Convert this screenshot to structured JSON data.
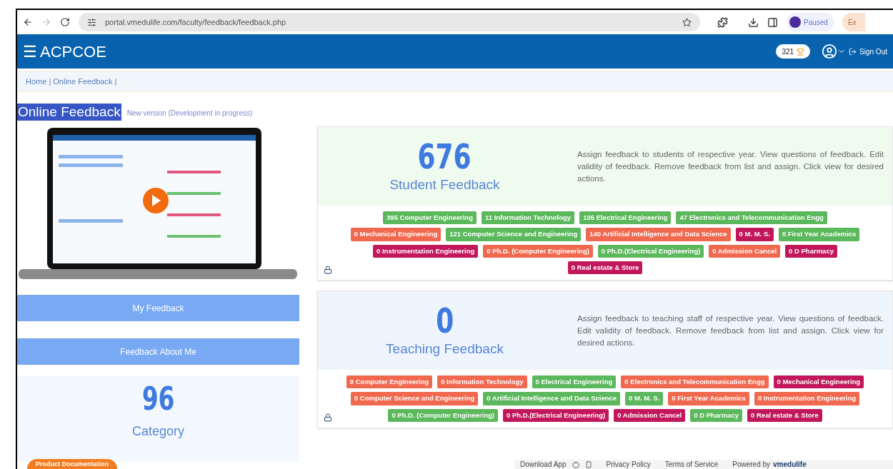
{
  "browser": {
    "url": "portal.vmedulife.com/faculty/feedback/feedback.php",
    "profile": "Paused",
    "extra": "Ex"
  },
  "header": {
    "menu_glyph": "☰",
    "brand": "ACPCOE",
    "points": "321",
    "sign_out": "Sign Out"
  },
  "breadcrumb": "Home | Online Feedback |",
  "page": {
    "title": "Online Feedback",
    "subtitle": "New version (Development in progress)"
  },
  "left": {
    "buttons": [
      "My Feedback",
      "Feedback About Me"
    ],
    "category": {
      "count": "96",
      "label": "Category"
    },
    "doc_badge": "Product Documentation"
  },
  "cards": [
    {
      "count": "676",
      "label": "Student Feedback",
      "color": "#effbee",
      "description": "Assign feedback to students of respective year. View questions of feedback. Edit validity of feedback. Remove feedback from list and assign. Click view for desired actions.",
      "tags": [
        {
          "text": "395 Computer Engineering",
          "color": "#5cb85c"
        },
        {
          "text": "11 Information Technology",
          "color": "#5cb85c"
        },
        {
          "text": "105 Electrical Engineering",
          "color": "#5cb85c"
        },
        {
          "text": "47 Electronics and Telecommunication Engg",
          "color": "#5cb85c"
        },
        {
          "text": "0 Mechanical Engineering",
          "color": "#f0694f"
        },
        {
          "text": "121 Computer Science and Engineering",
          "color": "#5cb85c"
        },
        {
          "text": "140 Artificial Intelligence and Data Science",
          "color": "#f0694f"
        },
        {
          "text": "0 M. M. S.",
          "color": "#c2185b"
        },
        {
          "text": "0 First Year Academics",
          "color": "#5cb85c"
        },
        {
          "text": "0 Instrumentation Engineering",
          "color": "#c2185b"
        },
        {
          "text": "0 Ph.D. (Computer Engineering)",
          "color": "#f0694f"
        },
        {
          "text": "0 Ph.D.(Electrical Engineering)",
          "color": "#5cb85c"
        },
        {
          "text": "0 Admission Cancel",
          "color": "#f0694f"
        },
        {
          "text": "0 D Pharmacy",
          "color": "#c2185b"
        },
        {
          "text": "0 Real estate & Store",
          "color": "#c2185b"
        }
      ]
    },
    {
      "count": "0",
      "label": "Teaching Feedback",
      "color": "#eef5fd",
      "description": "Assign feedback to teaching staff of respective year. View questions of feedback. Edit validity of feedback. Remove feedback from list and assign. Click view for desired actions.",
      "tags": [
        {
          "text": "0 Computer Engineering",
          "color": "#f0694f"
        },
        {
          "text": "0 Information Technology",
          "color": "#f0694f"
        },
        {
          "text": "0 Electrical Engineering",
          "color": "#5cb85c"
        },
        {
          "text": "0 Electronics and Telecommunication Engg",
          "color": "#f0694f"
        },
        {
          "text": "0 Mechanical Engineering",
          "color": "#c2185b"
        },
        {
          "text": "0 Computer Science and Engineering",
          "color": "#f0694f"
        },
        {
          "text": "0 Artificial Intelligence and Data Science",
          "color": "#5cb85c"
        },
        {
          "text": "0 M. M. S.",
          "color": "#5cb85c"
        },
        {
          "text": "0 First Year Academics",
          "color": "#f0694f"
        },
        {
          "text": "0 Instrumentation Engineering",
          "color": "#f0694f"
        },
        {
          "text": "0 Ph.D. (Computer Engineering)",
          "color": "#5cb85c"
        },
        {
          "text": "0 Ph.D.(Electrical Engineering)",
          "color": "#c2185b"
        },
        {
          "text": "0 Admission Cancel",
          "color": "#c2185b"
        },
        {
          "text": "0 D Pharmacy",
          "color": "#5cb85c"
        },
        {
          "text": "0 Real estate & Store",
          "color": "#c2185b"
        }
      ]
    }
  ],
  "footer": {
    "download": "Download App",
    "links": [
      "Privacy Policy",
      "Terms of Service"
    ],
    "powered_label": "Powered by",
    "powered_brand": "vmedulife"
  }
}
